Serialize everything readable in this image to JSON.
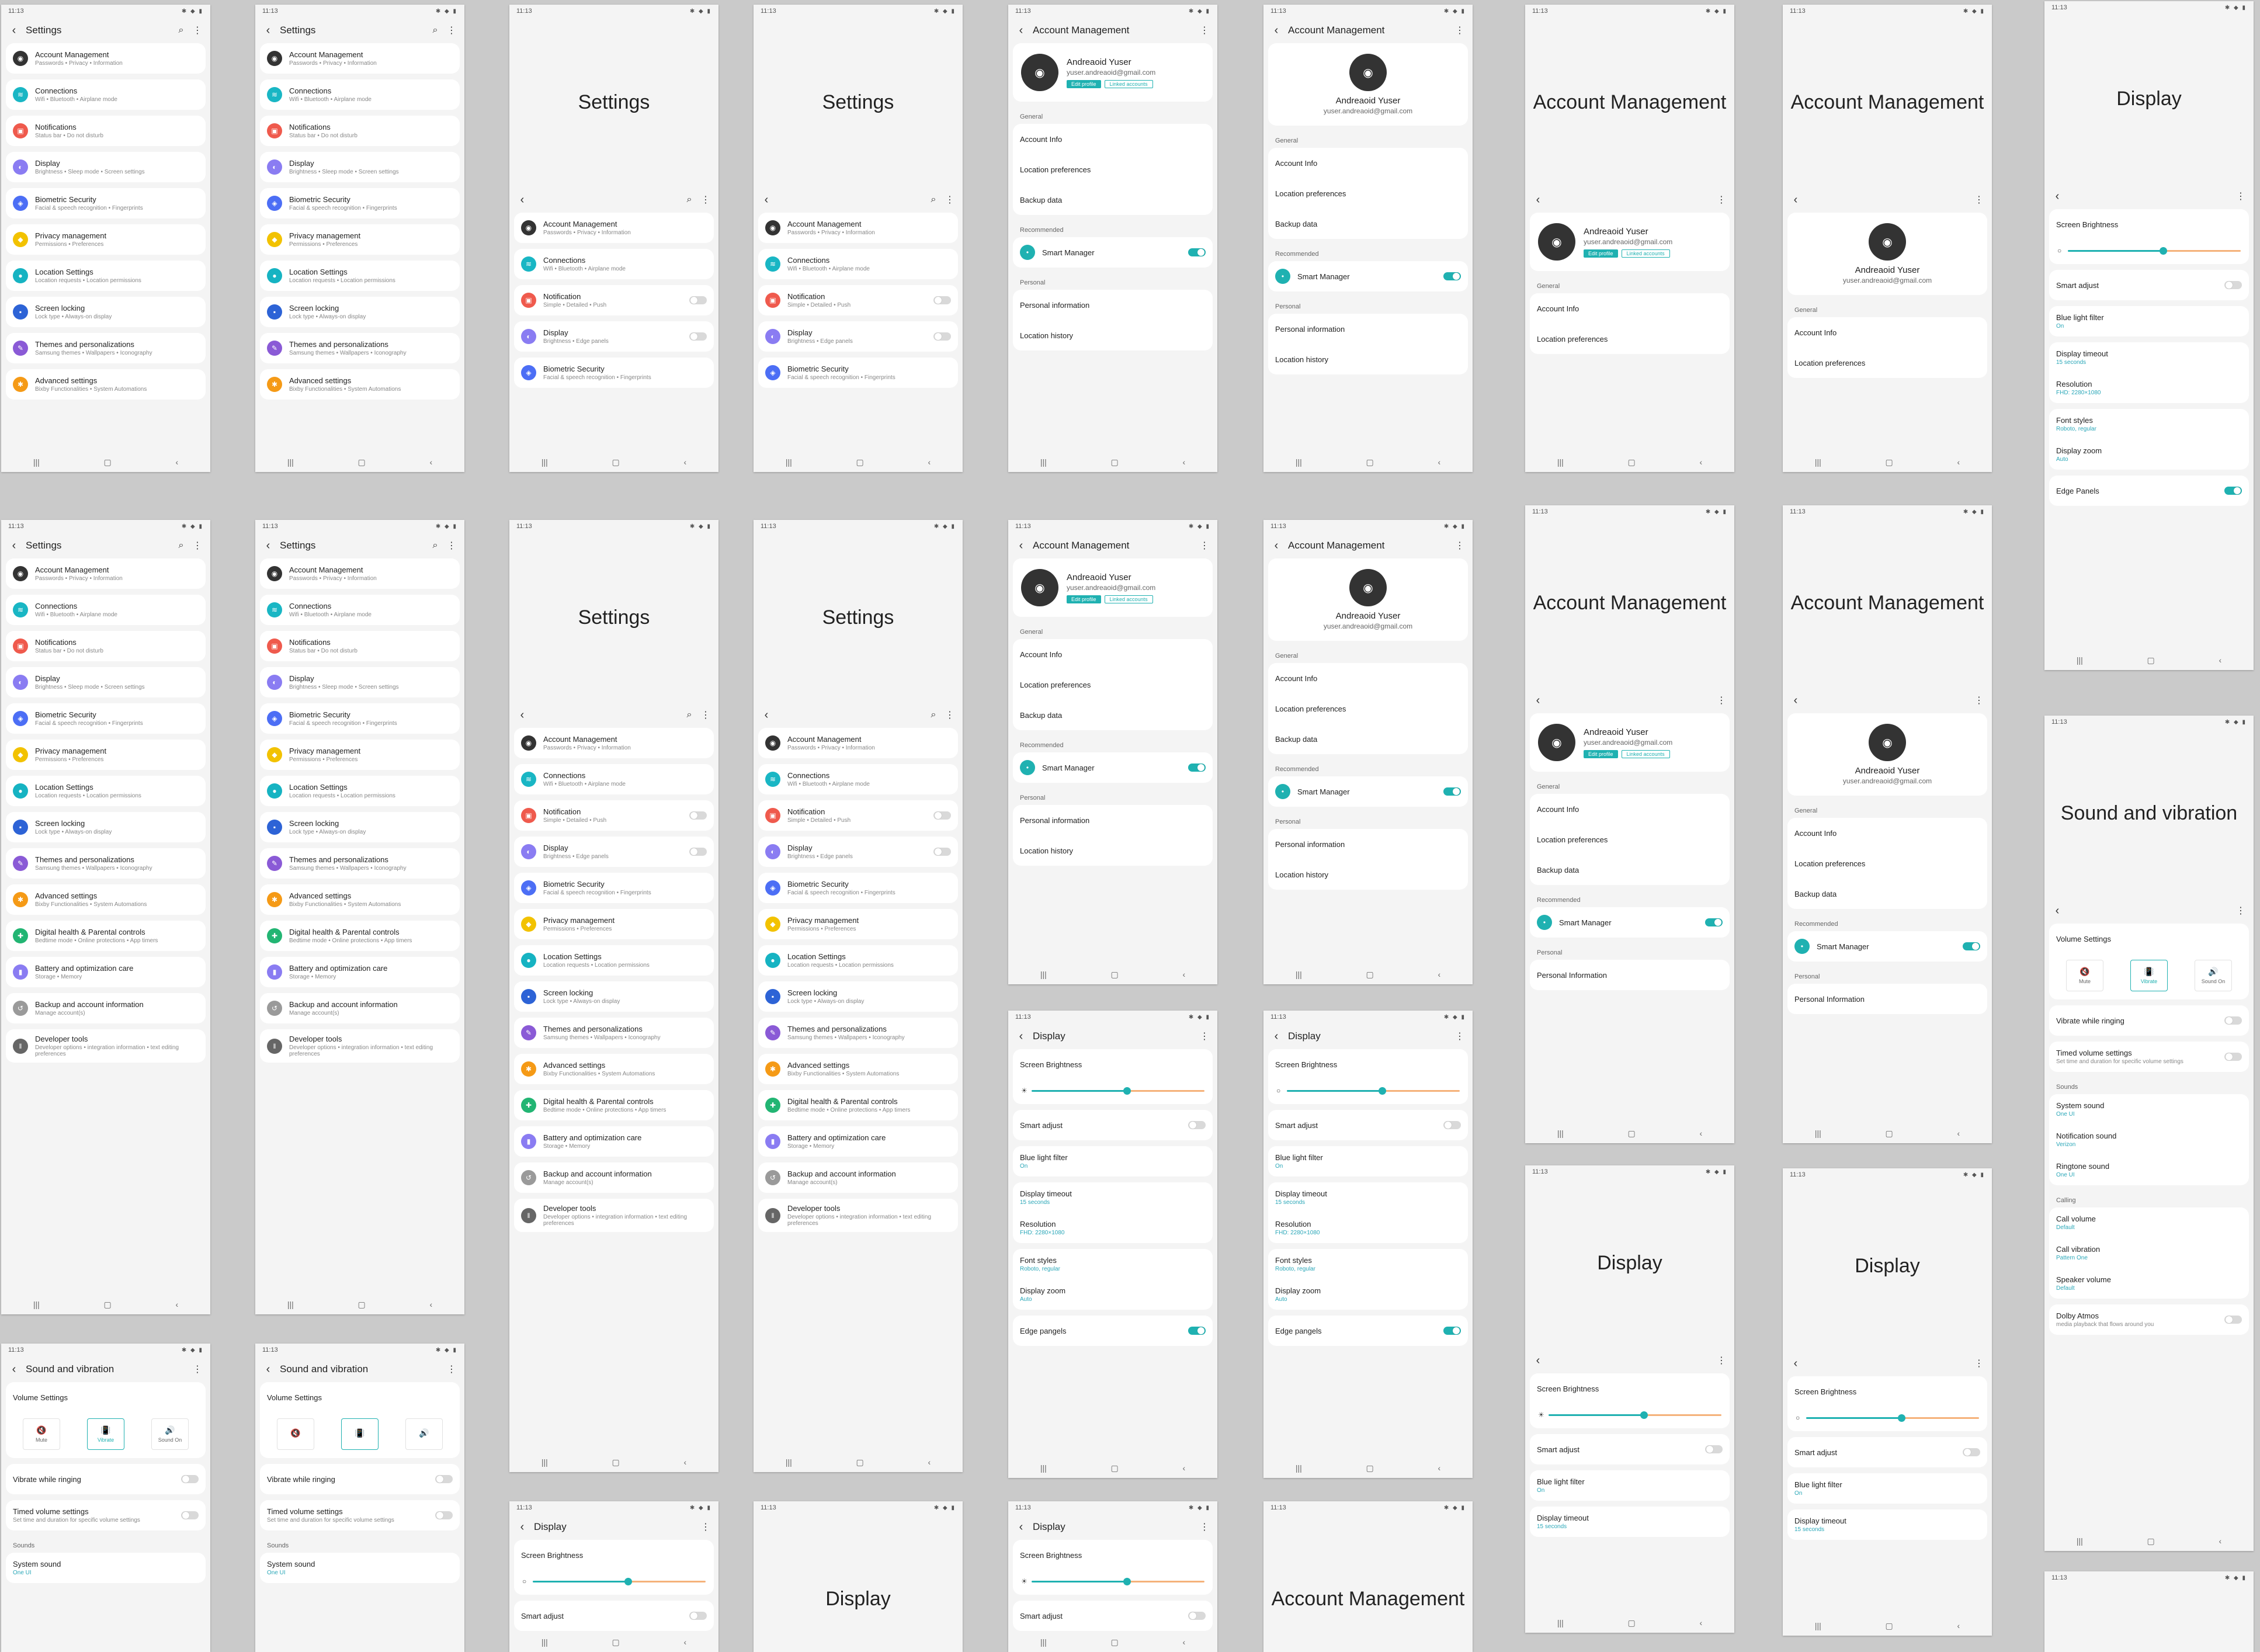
{
  "status": {
    "time": "11:13",
    "icons": "✱ ◆ ▮"
  },
  "nav": {
    "recent": "|||",
    "home": "▢",
    "back": "‹"
  },
  "settings": {
    "title": "Settings",
    "items": [
      {
        "label": "Account Management",
        "sub": "Passwords • Privacy • Information",
        "icon": "avatar-icon",
        "color": "#333333"
      },
      {
        "label": "Connections",
        "sub": "Wifi • Bluetooth • Airplane mode",
        "icon": "wifi-icon",
        "color": "#19b6c4"
      },
      {
        "label": "Notifications",
        "sub": "Status bar • Do not disturb",
        "icon": "bell-icon",
        "color": "#ef5a4d"
      },
      {
        "label": "Display",
        "sub": "Brightness • Sleep mode • Screen settings",
        "icon": "display-icon",
        "color": "#8a7cf2"
      },
      {
        "label": "Biometric Security",
        "sub": "Facial & speech recognition • Fingerprints",
        "icon": "shield-icon",
        "color": "#4c6ef5"
      },
      {
        "label": "Privacy management",
        "sub": "Permissions • Preferences",
        "icon": "privacy-icon",
        "color": "#f2c200"
      },
      {
        "label": "Location Settings",
        "sub": "Location requests • Location permissions",
        "icon": "location-icon",
        "color": "#16b3c2"
      },
      {
        "label": "Screen locking",
        "sub": "Lock type • Always-on display",
        "icon": "lock-icon",
        "color": "#2d63d6"
      },
      {
        "label": "Themes and personalizations",
        "sub": "Samsung themes • Wallpapers • Iconography",
        "icon": "brush-icon",
        "color": "#8a5ad6"
      },
      {
        "label": "Advanced settings",
        "sub": "Bixby Functionalities • System Automations",
        "icon": "gear-icon",
        "color": "#f59a16"
      },
      {
        "label": "Digital health & Parental controls",
        "sub": "Bedtime mode • Online protections • App timers",
        "icon": "health-icon",
        "color": "#22b573"
      },
      {
        "label": "Battery and optimization care",
        "sub": "Storage • Memory",
        "icon": "battery-icon",
        "color": "#8a7cf2"
      },
      {
        "label": "Backup and account information",
        "sub": "Manage account(s)",
        "icon": "backup-icon",
        "color": "#9a9a9a"
      },
      {
        "label": "Developer tools",
        "sub": "Developer options • integration information • text editing preferences",
        "icon": "dev-icon",
        "color": "#666666"
      }
    ],
    "alt_items": [
      {
        "label": "Notification",
        "sub": "Simple • Detailed • Push"
      },
      {
        "label": "Display",
        "sub": "Brightness • Edge panels"
      }
    ],
    "alt_clipped": "Biometric Security",
    "clipped_themes": "Themes and personalizations"
  },
  "account": {
    "title": "Account Management",
    "name": "Andreaoid Yuser",
    "email": "yuser.andreaoid@gmail.com",
    "edit_profile": "Edit profile",
    "linked_accounts": "Linked accounts",
    "general_label": "General",
    "general": [
      "Account Info",
      "Location preferences",
      "Backup data"
    ],
    "recommended_label": "Recommended",
    "smart_manager": "Smart Manager",
    "personal_label": "Personal",
    "personal": [
      "Personal information",
      "Location history"
    ],
    "personal_alt": "Personal Information"
  },
  "display": {
    "title": "Display",
    "brightness_label": "Screen Brightness",
    "brightness_value": 0.55,
    "smart_adjust": "Smart adjust",
    "blue_light": "Blue light filter",
    "blue_light_value": "On",
    "timeout": "Display timeout",
    "timeout_value": "15 seconds",
    "resolution": "Resolution",
    "resolution_value": "FHD: 2280×1080",
    "font_styles": "Font styles",
    "font_styles_value": "Roboto, regular",
    "zoom": "Display zoom",
    "zoom_value": "Auto",
    "edge_panels": "Edge pangels",
    "edge_panels_alt": "Edge Panels"
  },
  "sound": {
    "title": "Sound and vibration",
    "volume_settings": "Volume Settings",
    "mute": "Mute",
    "vibrate": "Vibrate",
    "sound_on": "Sound On",
    "vibrate_ringing": "Vibrate while ringing",
    "timed": "Timed volume settings",
    "timed_sub": "Set time and duration for specific volume settings",
    "sounds_label": "Sounds",
    "system_sound": "System sound",
    "system_sound_value": "One UI",
    "notification_sound": "Notification sound",
    "notification_sound_value": "Verizon",
    "ringtone_sound": "Ringtone sound",
    "ringtone_sound_value": "One UI",
    "calling_label": "Calling",
    "call_volume": "Call volume",
    "call_volume_value": "Default",
    "call_vibration": "Call vibration",
    "call_vibration_value": "Pattern One",
    "speaker_volume": "Speaker volume",
    "speaker_volume_value": "Default",
    "dolby": "Dolby Atmos",
    "dolby_sub": "media playback that flows around you"
  }
}
